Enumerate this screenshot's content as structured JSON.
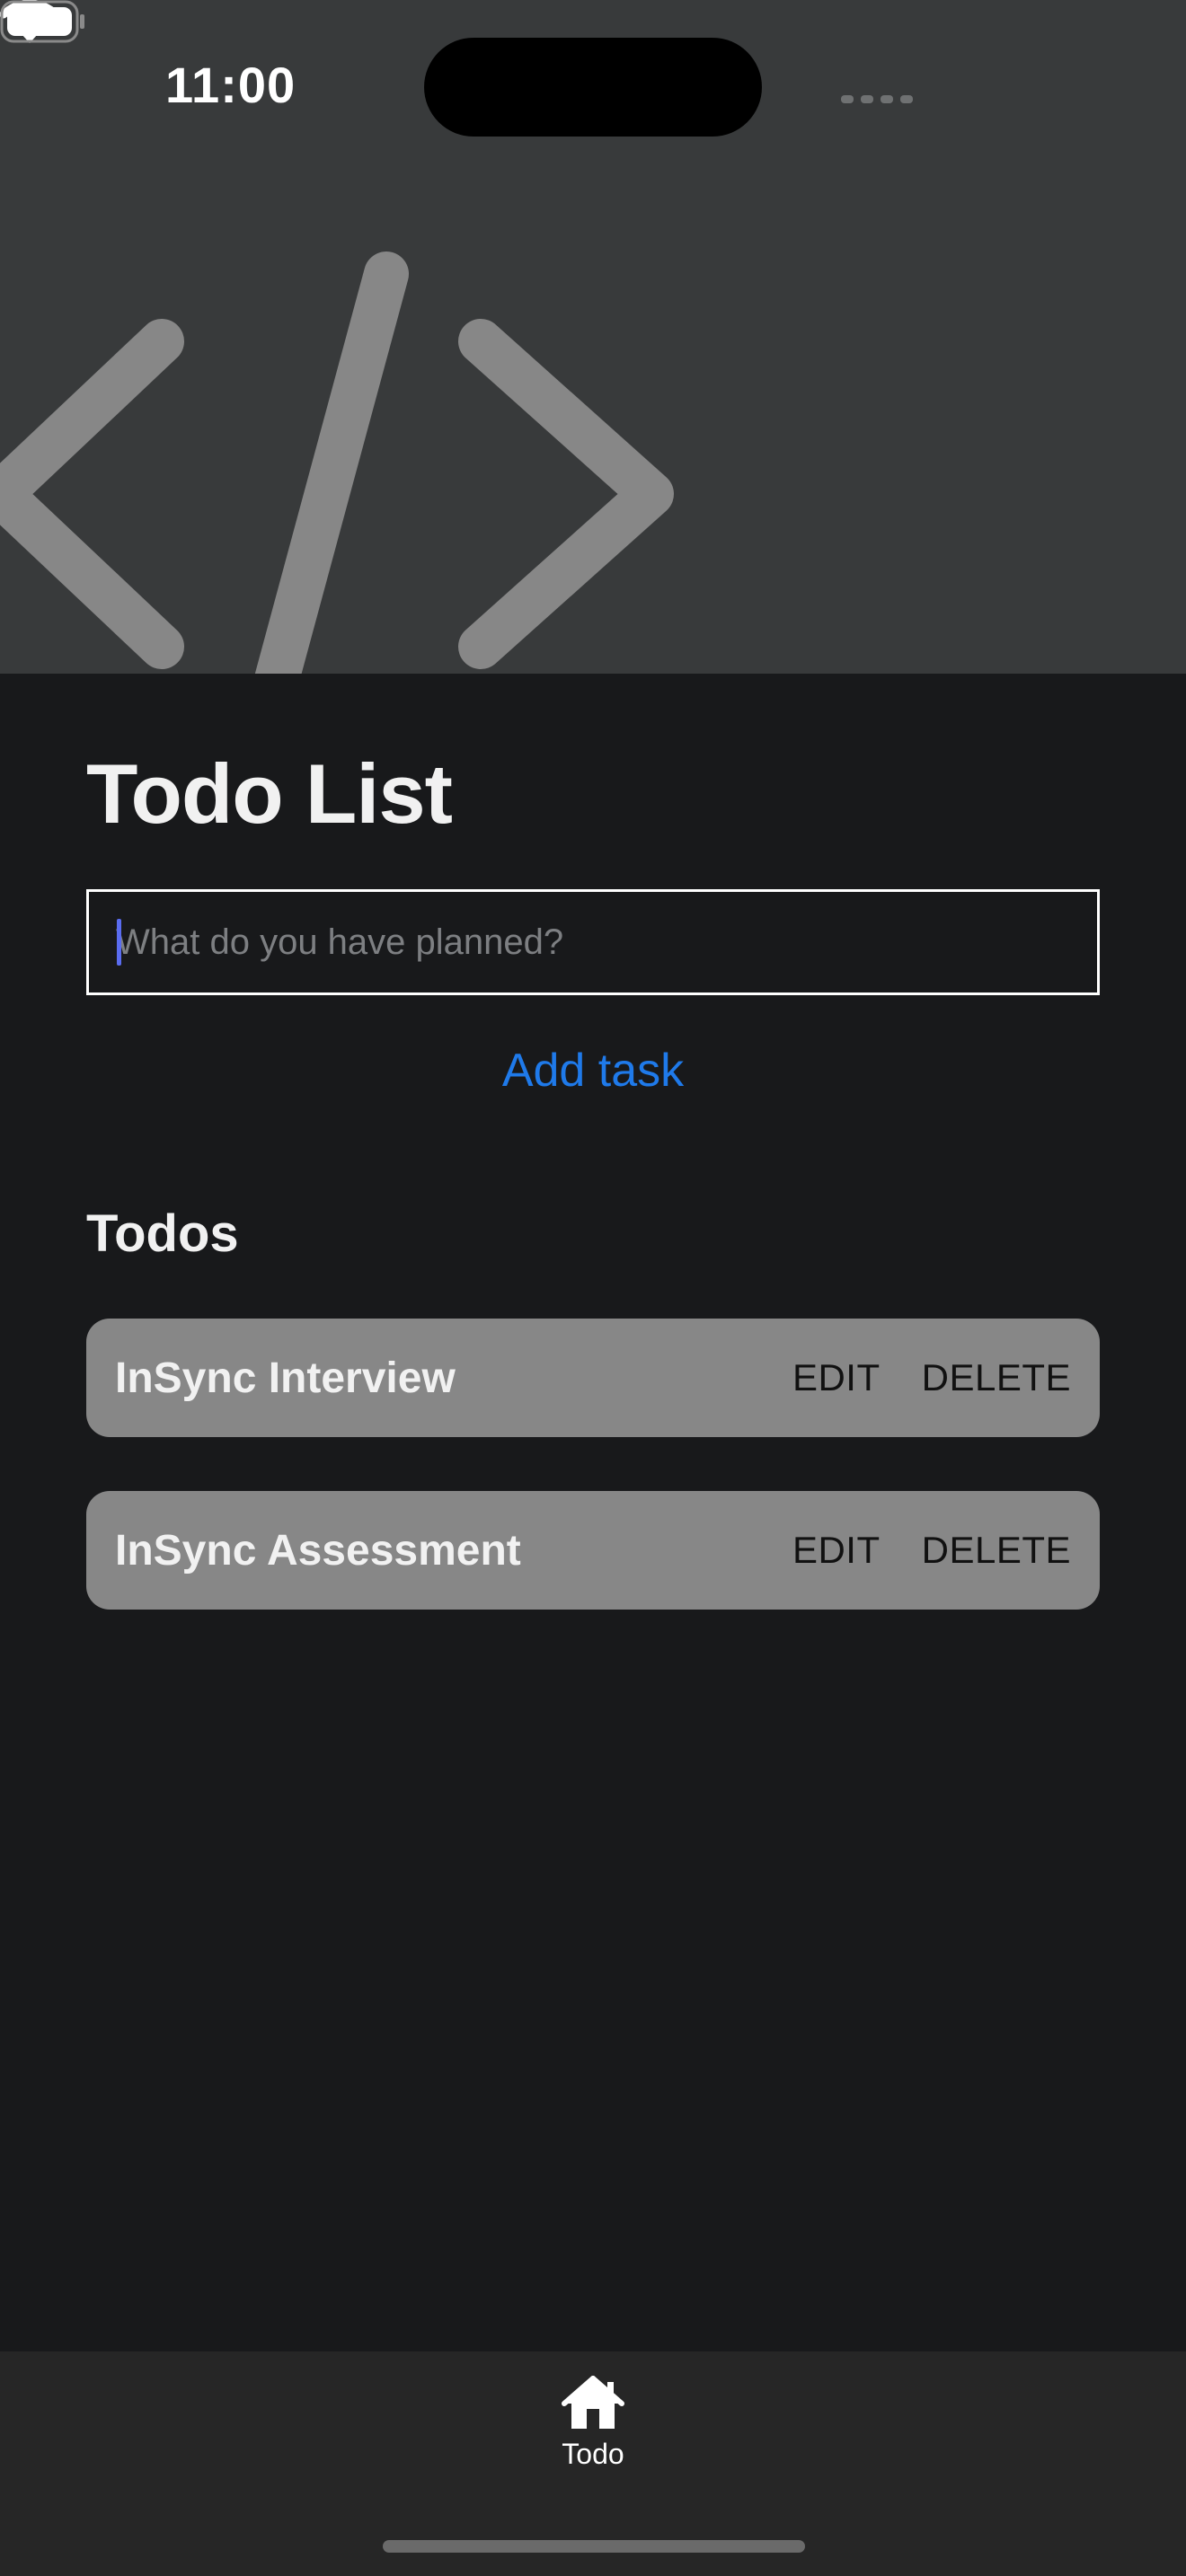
{
  "status_bar": {
    "time": "11:00",
    "signal_icon": "signal-dots-icon",
    "wifi_icon": "wifi-icon",
    "battery_icon": "battery-icon"
  },
  "hero": {
    "icon": "code-brackets-icon"
  },
  "main": {
    "title": "Todo List",
    "task_input": {
      "value": "",
      "placeholder": "What do you have planned?"
    },
    "add_task_label": "Add task",
    "section_heading": "Todos",
    "todos": [
      {
        "text": "InSync Interview",
        "edit_label": "EDIT",
        "delete_label": "DELETE"
      },
      {
        "text": "InSync Assessment",
        "edit_label": "EDIT",
        "delete_label": "DELETE"
      }
    ]
  },
  "tab_bar": {
    "tabs": [
      {
        "label": "Todo",
        "icon": "home-icon"
      }
    ]
  },
  "colors": {
    "background": "#18191b",
    "hero_background": "#383a3b",
    "accent": "#1f7aea",
    "todo_item_background": "#878787",
    "tab_bar_background": "#262626"
  }
}
